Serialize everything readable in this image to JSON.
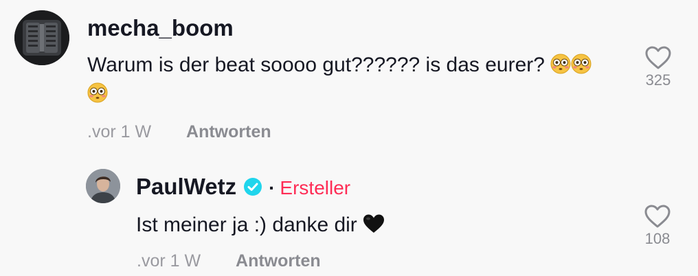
{
  "comment": {
    "username": "mecha_boom",
    "text": "Warum is der beat soooo gut?????? is das eurer?",
    "time": ".vor 1 W",
    "reply_label": "Antworten",
    "like_count": "325",
    "emoji_icons": [
      "flushed-face-icon",
      "flushed-face-icon",
      "flushed-face-icon"
    ]
  },
  "reply": {
    "username": "PaulWetz",
    "verified": true,
    "separator": "·",
    "badge": "Ersteller",
    "text": "Ist meiner ja :) danke dir",
    "emoji_icon": "black-heart-icon",
    "time": ".vor 1 W",
    "reply_label": "Antworten",
    "like_count": "108"
  },
  "colors": {
    "background": "#f8f8f8",
    "text": "#161823",
    "muted": "#8a8b91",
    "creator": "#fe2c55",
    "verified": "#20d5ec"
  }
}
